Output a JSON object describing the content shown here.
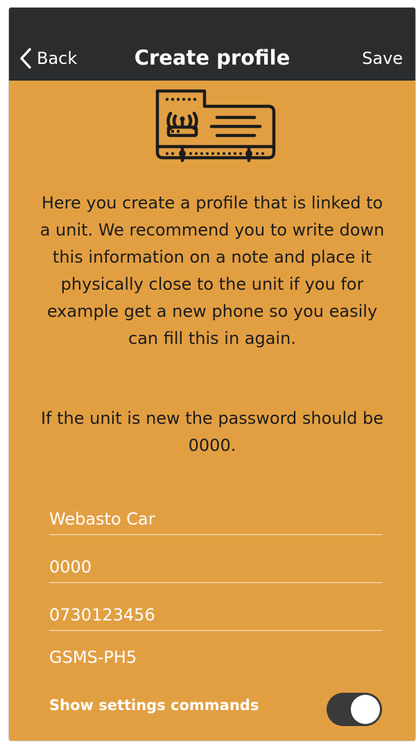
{
  "header": {
    "back_label": "Back",
    "title": "Create profile",
    "save_label": "Save",
    "icon": "chevron-left-icon"
  },
  "illustration": {
    "icon": "router-card-icon"
  },
  "intro_text": "Here you create a profile that is linked to a unit. We recommend you to write down this information on a note and place it physically close to the unit if you for example get a new phone so you easily can fill this in again.",
  "password_note": "If the unit is new the password should be 0000.",
  "form": {
    "name_value": "Webasto Car",
    "password_value": "0000",
    "phone_value": "0730123456",
    "unit_type": "GSMS-PH5",
    "toggle_label": "Show settings commands",
    "toggle_on": true
  },
  "colors": {
    "background": "#e29f42",
    "header": "#2b2c2e",
    "text": "#1c1c1c",
    "field_text": "#ffffff"
  }
}
